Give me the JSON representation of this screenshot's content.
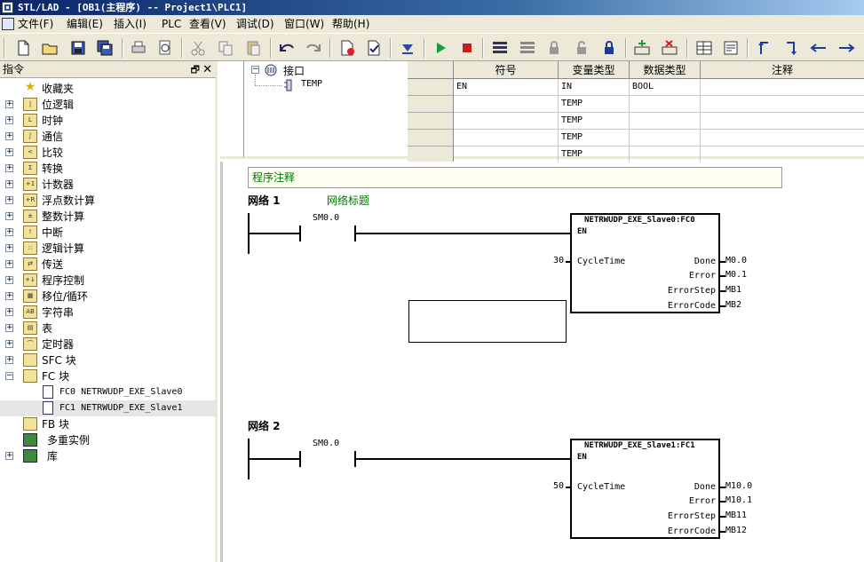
{
  "window": {
    "title": "STL/LAD - [OB1(主程序) -- Project1\\PLC1]"
  },
  "menu": [
    "文件(F)",
    "编辑(E)",
    "插入(I)",
    "PLC",
    "查看(V)",
    "调试(D)",
    "窗口(W)",
    "帮助(H)"
  ],
  "left_panel": {
    "title": "指令",
    "items": [
      {
        "label": "收藏夹",
        "icon": "star-icon"
      },
      {
        "label": "位逻辑",
        "icon": "folder-icon"
      },
      {
        "label": "时钟",
        "icon": "folder-icon"
      },
      {
        "label": "通信",
        "icon": "folder-icon"
      },
      {
        "label": "比较",
        "icon": "folder-icon"
      },
      {
        "label": "转换",
        "icon": "folder-icon"
      },
      {
        "label": "计数器",
        "icon": "folder-icon"
      },
      {
        "label": "浮点数计算",
        "icon": "folder-icon"
      },
      {
        "label": "整数计算",
        "icon": "folder-icon"
      },
      {
        "label": "中断",
        "icon": "folder-icon"
      },
      {
        "label": "逻辑计算",
        "icon": "folder-icon"
      },
      {
        "label": "传送",
        "icon": "folder-icon"
      },
      {
        "label": "程序控制",
        "icon": "folder-icon"
      },
      {
        "label": "移位/循环",
        "icon": "folder-icon"
      },
      {
        "label": "字符串",
        "icon": "folder-icon"
      },
      {
        "label": "表",
        "icon": "folder-icon"
      },
      {
        "label": "定时器",
        "icon": "folder-icon"
      },
      {
        "label": "SFC 块",
        "icon": "folder-icon"
      },
      {
        "label": "FC 块",
        "icon": "folder-icon"
      }
    ],
    "fc_children": [
      {
        "label": "FC0  NETRWUDP_EXE_Slave0"
      },
      {
        "label": "FC1  NETRWUDP_EXE_Slave1"
      }
    ],
    "tail": [
      {
        "label": "FB 块"
      },
      {
        "label": "多重实例"
      },
      {
        "label": "库"
      }
    ]
  },
  "interface": {
    "root": "接口",
    "child": "TEMP",
    "columns": [
      "符号",
      "变量类型",
      "数据类型",
      "注释"
    ],
    "rows": [
      [
        "EN",
        "IN",
        "BOOL",
        ""
      ],
      [
        "",
        "TEMP",
        "",
        ""
      ],
      [
        "",
        "TEMP",
        "",
        ""
      ],
      [
        "",
        "TEMP",
        "",
        ""
      ],
      [
        "",
        "TEMP",
        "",
        ""
      ]
    ]
  },
  "editor": {
    "program_comment": "程序注释",
    "networks": [
      {
        "label": "网络 1",
        "title": "网络标题",
        "contact": "SM0.0",
        "block": "NETRWUDP_EXE_Slave0:FC0",
        "en": "EN",
        "cycle_value": "30",
        "cycle_pin": "CycleTime",
        "outputs": [
          {
            "pin": "Done",
            "value": "M0.0"
          },
          {
            "pin": "Error",
            "value": "M0.1"
          },
          {
            "pin": "ErrorStep",
            "value": "MB1"
          },
          {
            "pin": "ErrorCode",
            "value": "MB2"
          }
        ]
      },
      {
        "label": "网络 2",
        "title": "",
        "contact": "SM0.0",
        "block": "NETRWUDP_EXE_Slave1:FC1",
        "en": "EN",
        "cycle_value": "50",
        "cycle_pin": "CycleTime",
        "outputs": [
          {
            "pin": "Done",
            "value": "M10.0"
          },
          {
            "pin": "Error",
            "value": "M10.1"
          },
          {
            "pin": "ErrorStep",
            "value": "MB11"
          },
          {
            "pin": "ErrorCode",
            "value": "MB12"
          }
        ]
      }
    ]
  }
}
